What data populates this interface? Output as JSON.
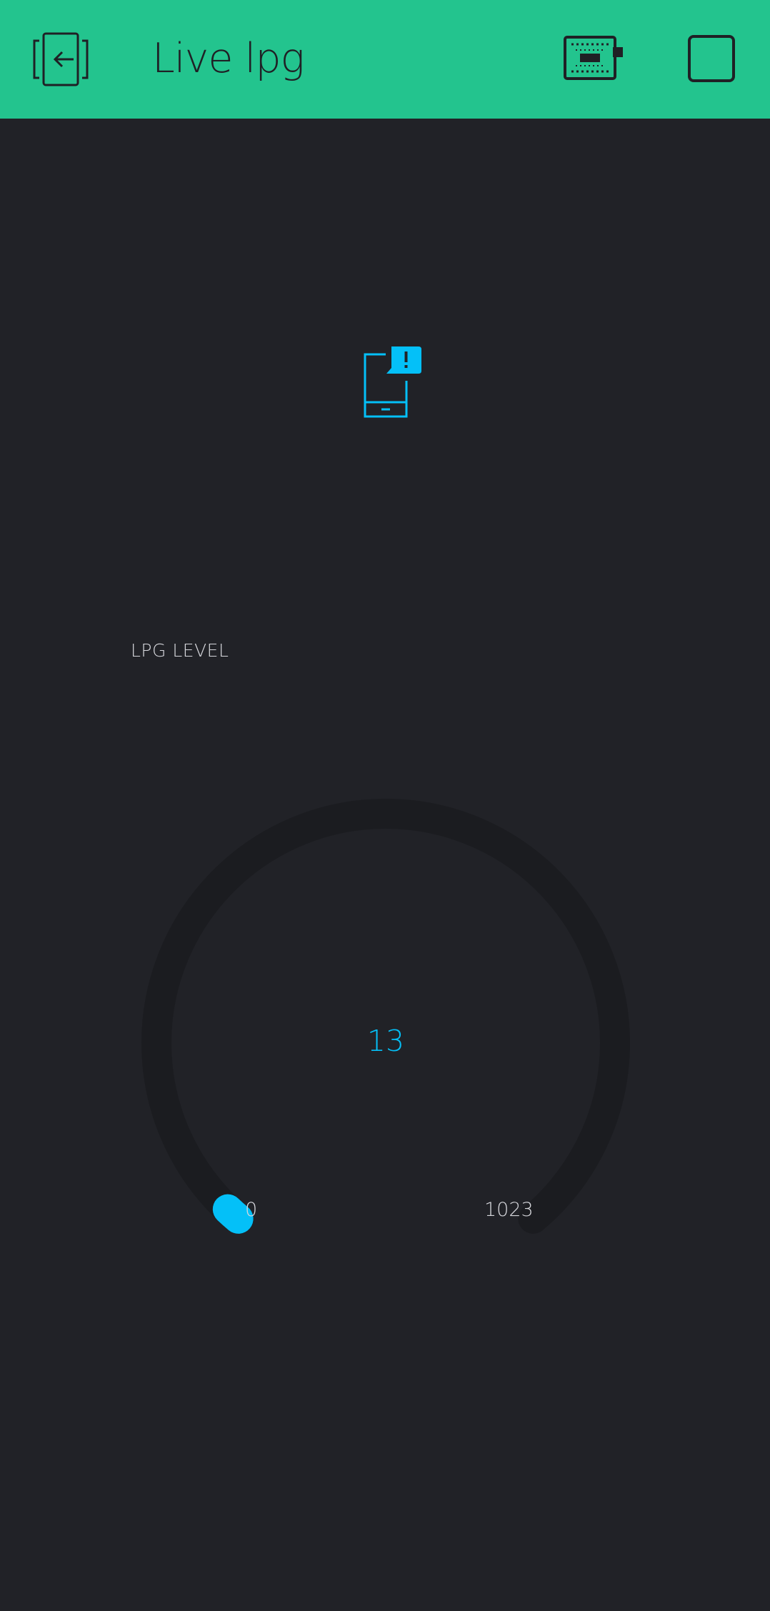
{
  "app": {
    "title": "Live lpg",
    "accent_color": "#23c48e",
    "background_color": "#212227",
    "widget_color": "#04c0f8"
  },
  "toolbar": {
    "back_icon": "exit-icon",
    "device_icon": "hardware-device-icon",
    "stop_icon": "stop-square-icon"
  },
  "notification": {
    "icon": "phone-alert-icon"
  },
  "gauge": {
    "label": "LPG LEVEL",
    "value": "13",
    "min": "0",
    "max": "1023",
    "fraction": 0.0127
  }
}
